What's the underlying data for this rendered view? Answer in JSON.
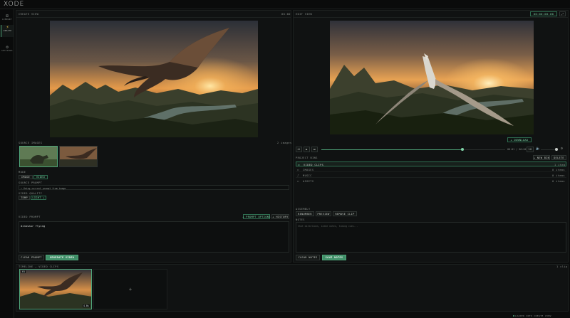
{
  "app": {
    "logo": "XODE",
    "status": "LOADED INTO CREATE VIEW"
  },
  "nav": [
    {
      "label": "LIBRARY",
      "icon": "grid-icon"
    },
    {
      "label": "CREATE",
      "icon": "bolt-icon"
    },
    {
      "label": "SETTINGS",
      "icon": "gear-icon"
    }
  ],
  "create": {
    "title": "CREATE VIEW",
    "mini": "00:00",
    "source_images_label": "SOURCE IMAGES",
    "image_count": "2 images",
    "mode_label": "MODE",
    "mode_options": [
      "IMAGE",
      "VIDEO"
    ],
    "source_prompt_label": "SOURCE PROMPT",
    "source_prompt_value": "• Using current prompt from image",
    "video_quality_label": "VIDEO QUALITY",
    "quality_options": [
      "TEMP",
      "LIGHT +"
    ],
    "video_prompt_label": "VIDEO PROMPT",
    "prompt_options_btn": "+ PROMPT OPTIONS",
    "history_btn": "+ HISTORY",
    "video_prompt_value": "dinosaur flying",
    "clear_prompt": "CLEAR PROMPT",
    "generate_video": "GENERATE VIDEO"
  },
  "edit": {
    "title": "EDIT VIEW",
    "timecode": "00:00:00:00",
    "download": "+ DOWNLOAD",
    "time_display": "00:01 / 00:04",
    "speed": "1x",
    "project bins_label": "PROJECT BINS",
    "new_bin": "+ NEW BIN",
    "delete": "DELETE",
    "bins": [
      {
        "name": "VIDEO CLIPS",
        "count": "1 item"
      },
      {
        "name": "IMAGES",
        "count": "0 items"
      },
      {
        "name": "MUSIC",
        "count": "0 items"
      },
      {
        "name": "ASSETS",
        "count": "0 items"
      }
    ],
    "assembly_label": "ASSEMBLY",
    "assembly_buttons": [
      "RENUMBER",
      "PREVIEW",
      "REMOVE CLIP"
    ],
    "notes_label": "NOTES",
    "notes_placeholder": "Shot directions, scene notes, timing cues...",
    "clear_notes": "CLEAR NOTES",
    "save_notes": "SAVE NOTES"
  },
  "timeline": {
    "label": "TIMELINE — VIDEO CLIPS",
    "count": "1 clip",
    "clip_number": "01",
    "clip_duration": "4.0s",
    "add_symbol": "+"
  },
  "colors": {
    "accent": "#3f8e67",
    "accent_light": "#7fd1a6",
    "bg": "#0b0c0c",
    "panel": "#101212"
  }
}
